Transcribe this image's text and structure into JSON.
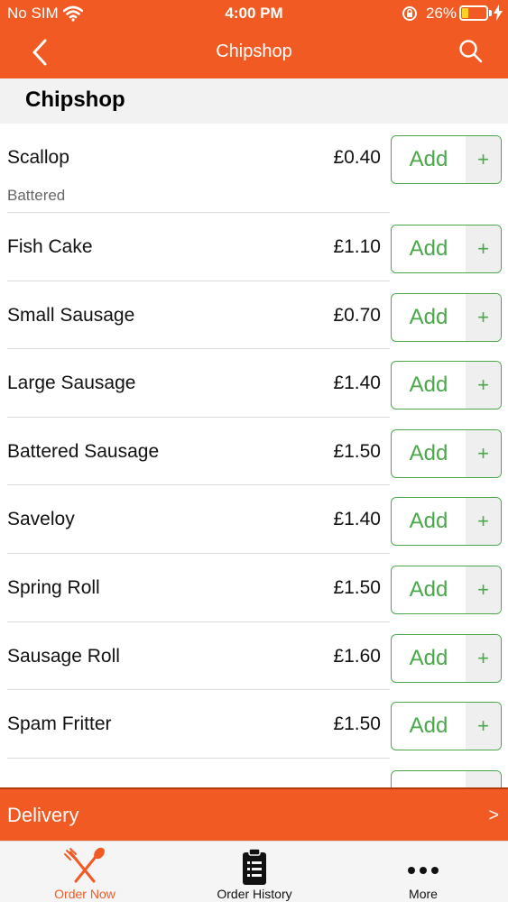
{
  "status_bar": {
    "carrier": "No SIM",
    "time": "4:00 PM",
    "battery_percent": "26%",
    "battery_level": 0.26
  },
  "nav": {
    "title": "Chipshop"
  },
  "section": {
    "title": "Chipshop"
  },
  "items": [
    {
      "name": "Scallop",
      "subtitle": "Battered",
      "price": "£0.40",
      "add_label": "Add",
      "plus": "+"
    },
    {
      "name": "Fish Cake",
      "price": "£1.10",
      "add_label": "Add",
      "plus": "+"
    },
    {
      "name": "Small Sausage",
      "price": "£0.70",
      "add_label": "Add",
      "plus": "+"
    },
    {
      "name": "Large Sausage",
      "price": "£1.40",
      "add_label": "Add",
      "plus": "+"
    },
    {
      "name": "Battered Sausage",
      "price": "£1.50",
      "add_label": "Add",
      "plus": "+"
    },
    {
      "name": "Saveloy",
      "price": "£1.40",
      "add_label": "Add",
      "plus": "+"
    },
    {
      "name": "Spring Roll",
      "price": "£1.50",
      "add_label": "Add",
      "plus": "+"
    },
    {
      "name": "Sausage Roll",
      "price": "£1.60",
      "add_label": "Add",
      "plus": "+"
    },
    {
      "name": "Spam Fritter",
      "price": "£1.50",
      "add_label": "Add",
      "plus": "+"
    },
    {
      "name": "",
      "price": "",
      "add_label": "",
      "plus": ""
    }
  ],
  "delivery": {
    "label": "Delivery",
    "chevron": ">"
  },
  "tabs": [
    {
      "label": "Order Now",
      "icon": "fork-knife-icon"
    },
    {
      "label": "Order History",
      "icon": "clipboard-icon"
    },
    {
      "label": "More",
      "icon": "more-dots-icon"
    }
  ],
  "colors": {
    "brand": "#f15a22",
    "accent_green": "#4aa84a",
    "battery": "#ffd21f"
  }
}
